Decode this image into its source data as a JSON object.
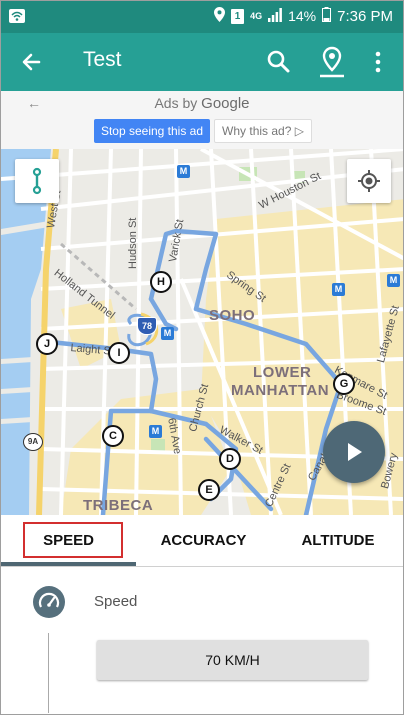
{
  "status_bar": {
    "battery": "14%",
    "time": "7:36 PM",
    "network": "4G",
    "sim_badge": "1"
  },
  "app_bar": {
    "title": "Test",
    "icons": [
      "back-arrow-icon",
      "search-icon",
      "location-pin-icon",
      "more-vert-icon"
    ]
  },
  "ad": {
    "ads_by": "Ads by",
    "brand": "Google",
    "stop_label": "Stop seeing this ad",
    "why_label": "Why this ad? ▷"
  },
  "map": {
    "streets": [
      "West St",
      "Holland Tunnel",
      "Hudson St",
      "Varick St",
      "W Houston St",
      "Spring St",
      "Laight St",
      "6th Ave",
      "Church St",
      "Walker St",
      "Centre St",
      "Canal St",
      "Kenmare St",
      "Broome St",
      "Lafayette St",
      "Bowery"
    ],
    "districts": [
      "SOHO",
      "LOWER",
      "MANHATTAN",
      "TRIBECA"
    ],
    "markers": [
      "H",
      "J",
      "I",
      "G",
      "C",
      "D",
      "E"
    ],
    "highway_shield": "78",
    "route_9a": "9A",
    "subway_symbol": "M",
    "colors": {
      "water": "#a4cdf2",
      "route": "#78a6e0",
      "commercial": "#f7e9b8",
      "park": "#c7e5b6"
    }
  },
  "tabs": [
    {
      "label": "SPEED",
      "selected": true
    },
    {
      "label": "ACCURACY",
      "selected": false
    },
    {
      "label": "ALTITUDE",
      "selected": false
    }
  ],
  "speed_panel": {
    "title": "Speed",
    "value": "70 KM/H"
  },
  "colors": {
    "status_bar": "#1f8a7e",
    "app_bar": "#26a095",
    "tab_indicator": "#4f6773",
    "highlight_box": "#d32f2f",
    "play_button": "#4e6876"
  }
}
